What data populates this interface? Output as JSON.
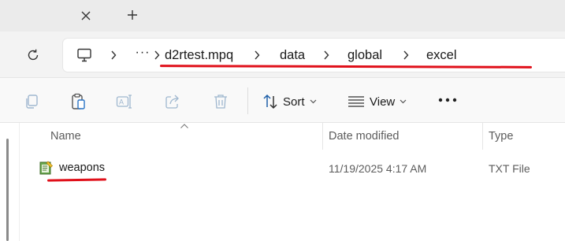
{
  "tabs": {
    "close_icon": "close-icon",
    "new_tab_icon": "plus-icon"
  },
  "address": {
    "refresh_icon": "refresh-icon",
    "root_icon": "this-pc-icon",
    "overflow": "···",
    "breadcrumbs": [
      "d2rtest.mpq",
      "data",
      "global",
      "excel"
    ]
  },
  "commands": {
    "icons": [
      "copy-icon",
      "paste-icon",
      "rename-icon",
      "share-icon",
      "delete-icon"
    ],
    "sort_label": "Sort",
    "view_label": "View",
    "more_icon": "more-options-icon"
  },
  "file_list": {
    "columns": [
      "Name",
      "Date modified",
      "Type"
    ],
    "rows": [
      {
        "name": "weapons",
        "date_modified": "11/19/2025 4:17 AM",
        "type": "TXT File",
        "icon": "notepad-file-icon"
      }
    ]
  },
  "colors": {
    "annotation": "#e0101a",
    "tabstrip_bg": "#ebebeb",
    "address_bg": "#f3f3f3",
    "command_bg": "#f9f9f9"
  }
}
